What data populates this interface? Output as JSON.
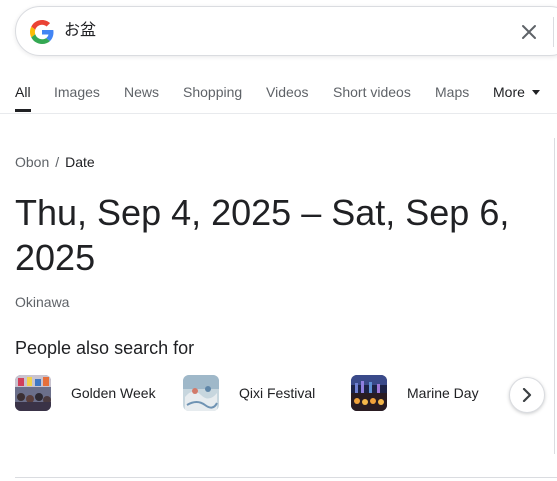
{
  "search": {
    "query": "お盆",
    "clear_icon": "close-icon",
    "logo_icon": "google-g-icon"
  },
  "tabs": [
    {
      "label": "All",
      "active": true
    },
    {
      "label": "Images"
    },
    {
      "label": "News"
    },
    {
      "label": "Shopping"
    },
    {
      "label": "Videos"
    },
    {
      "label": "Short videos"
    },
    {
      "label": "Maps"
    }
  ],
  "more_tab": {
    "label": "More",
    "icon": "caret-down-icon"
  },
  "breadcrumb": {
    "parent": "Obon",
    "separator": "/",
    "current": "Date"
  },
  "answer": {
    "date_range": "Thu, Sep 4, 2025 – Sat, Sep 6, 2025",
    "location": "Okinawa"
  },
  "people_also_search": {
    "title": "People also search for",
    "items": [
      {
        "label": "Golden Week"
      },
      {
        "label": "Qixi Festival"
      },
      {
        "label": "Marine Day"
      }
    ],
    "next_icon": "chevron-right-icon"
  },
  "colors": {
    "text_primary": "#202124",
    "text_secondary": "#5f6368",
    "border": "#dadce0",
    "google_blue": "#4285F4",
    "google_red": "#EA4335",
    "google_yellow": "#FBBC05",
    "google_green": "#34A853"
  }
}
